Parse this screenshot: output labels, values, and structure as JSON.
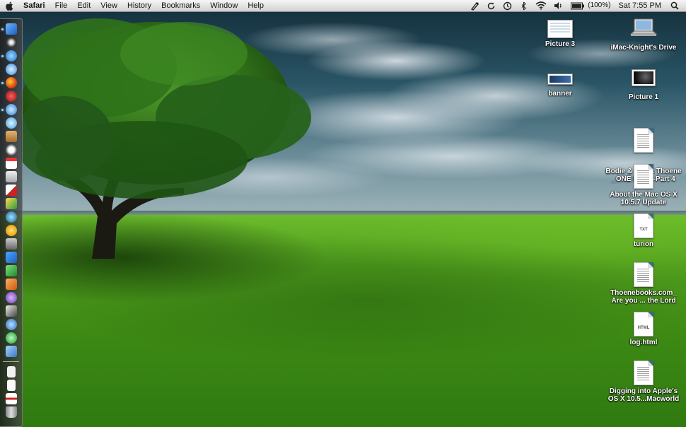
{
  "menubar": {
    "app_name": "Safari",
    "menus": [
      "File",
      "Edit",
      "View",
      "History",
      "Bookmarks",
      "Window",
      "Help"
    ],
    "battery_text": "(100%)",
    "clock": "Sat 7:55 PM"
  },
  "status_icons": [
    "script-menu-icon",
    "sync-icon",
    "time-machine-icon",
    "bluetooth-icon",
    "wifi-icon",
    "volume-icon",
    "battery-icon",
    "spotlight-icon"
  ],
  "dock": {
    "items": [
      "finder",
      "dashboard",
      "mail",
      "ichat",
      "firefox",
      "itunes-alt",
      "safari",
      "itunes",
      "address-book",
      "clock",
      "ical",
      "preview",
      "solitaire",
      "photo-booth",
      "system-preferences",
      "iphoto",
      "adium",
      "word",
      "excel",
      "powerpoint",
      "entourage",
      "chess",
      "app-store",
      "calculator",
      "utility"
    ],
    "stacks": [
      "documents-stack",
      "downloads-stack",
      "photo-stack",
      "trash"
    ]
  },
  "desktop": {
    "icons": [
      {
        "label": "Picture 3",
        "kind": "image"
      },
      {
        "label": "iMac-Knight's Drive",
        "kind": "drive"
      },
      {
        "label": "banner",
        "kind": "image"
      },
      {
        "label": "Picture 1",
        "kind": "image"
      },
      {
        "label": "Bodie & Brock Thoene\n_ONE MI...T--Part 4",
        "kind": "document"
      },
      {
        "label": "About the Mac OS X\n10.5.7 Update",
        "kind": "document"
      },
      {
        "label": "turion",
        "kind": "text",
        "tag": "TXT"
      },
      {
        "label": "Thoenebooks.com_\nAre you ... the Lord",
        "kind": "document"
      },
      {
        "label": "log.html",
        "kind": "html",
        "tag": "HTML"
      },
      {
        "label": "Digging into Apple's\nOS X 10.5...Macworld",
        "kind": "document"
      }
    ]
  },
  "colors": {
    "menubar": "#e2e2e2",
    "sky_dark": "#16323f",
    "grass": "#4e9a1c"
  }
}
